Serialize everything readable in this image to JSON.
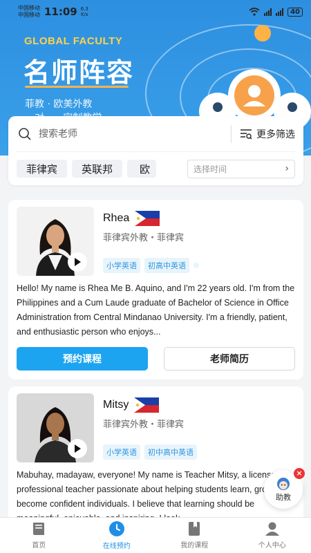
{
  "status_bar": {
    "carrier1": "中国移动",
    "carrier2": "中国移动",
    "time": "11:09",
    "speed_value": "6.3",
    "speed_unit": "K/s",
    "battery": "40"
  },
  "hero": {
    "subtitle_en": "GLOBAL FACULTY",
    "title": "名师阵容",
    "tagline": "菲教 · 欧美外教",
    "tagline2": "一对一 · 定制教学"
  },
  "search": {
    "placeholder": "搜索老师",
    "filter_label": "更多筛选"
  },
  "region_chips": [
    "菲律宾",
    "英联邦",
    "欧"
  ],
  "time_select": {
    "placeholder": "选择时间"
  },
  "teachers": [
    {
      "name": "Rhea",
      "meta": "菲律宾外教・菲律宾",
      "tags": [
        "小学英语",
        "初高中英语"
      ],
      "bio": "Hello! My name is Rhea Me B. Aquino, and I'm 22 years old. I'm from the Philippines and a Cum Laude graduate of Bachelor of Science in Office Administration from Central Mindanao University. I'm a friendly, patient, and enthusiastic person who enjoys...",
      "book_label": "预约课程",
      "profile_label": "老师简历"
    },
    {
      "name": "Mitsy",
      "meta": "菲律宾外教・菲律宾",
      "tags": [
        "小学英语",
        "初中高中英语"
      ],
      "bio": "Mabuhay, madayaw, everyone! My name is Teacher Mitsy, a licensed professional teacher passionate about helping students learn, grow, and become confident individuals. I believe that learning should be meaningful, enjoyable, and inspiring. I look"
    }
  ],
  "assistant": {
    "label": "助教",
    "close": "×"
  },
  "nav": [
    {
      "label": "首页",
      "icon": "book-icon"
    },
    {
      "label": "在线预约",
      "icon": "clock-icon"
    },
    {
      "label": "我的课程",
      "icon": "bookmark-icon"
    },
    {
      "label": "个人中心",
      "icon": "person-icon"
    }
  ],
  "colors": {
    "primary": "#1da4f0",
    "hero_bg": "#2d8fe0",
    "accent_yellow": "#ffd24a",
    "tag_text": "#2b94de"
  }
}
